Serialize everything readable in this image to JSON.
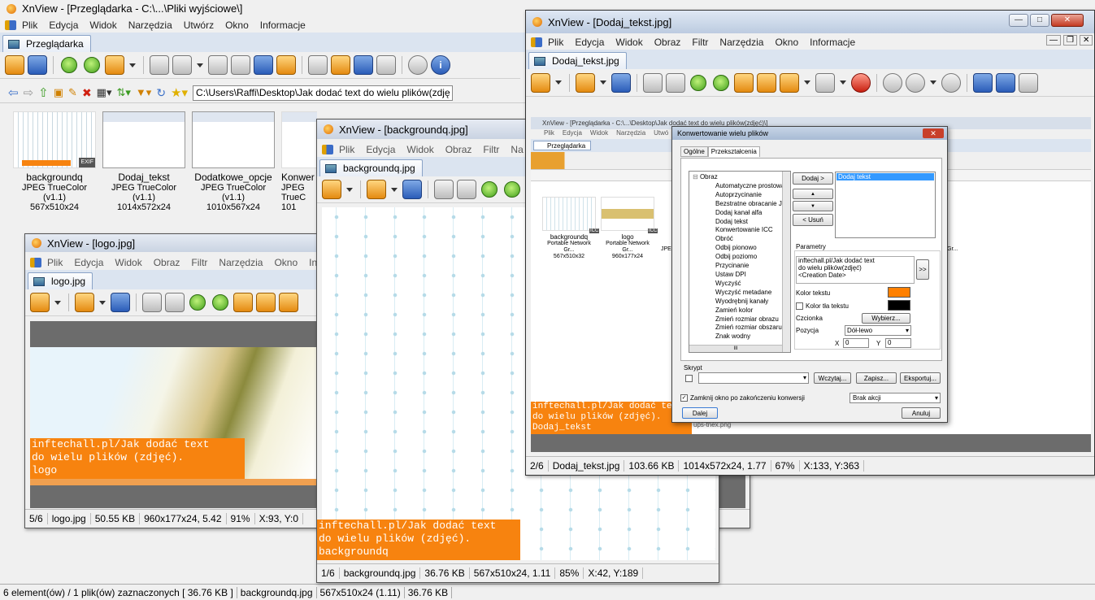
{
  "main": {
    "title": "XnView - [Przeglądarka - C:\\...\\Pliki wyjściowe\\]",
    "menu": [
      "Plik",
      "Edycja",
      "Widok",
      "Narzędzia",
      "Utwórz",
      "Okno",
      "Informacje"
    ],
    "tab": "Przeglądarka",
    "address": "C:\\Users\\Raffi\\Desktop\\Jak dodać text do wielu plików(zdję",
    "thumbs": [
      {
        "name": "backgroundq",
        "format": "JPEG TrueColor (v1.1)",
        "dims": "567x510x24"
      },
      {
        "name": "Dodaj_tekst",
        "format": "JPEG TrueColor (v1.1)",
        "dims": "1014x572x24"
      },
      {
        "name": "Dodatkowe_opcje",
        "format": "JPEG TrueColor (v1.1)",
        "dims": "1010x567x24"
      },
      {
        "name": "Konwer",
        "format": "JPEG TrueC",
        "dims": "101"
      }
    ],
    "exif": "EXIF",
    "status": [
      "6 element(ów) / 1 plik(ów) zaznaczonych  [ 36.76 KB ]",
      "backgroundq.jpg",
      "567x510x24 (1.11)",
      "36.76 KB"
    ]
  },
  "logo_win": {
    "title": "XnView - [logo.jpg]",
    "menu": [
      "Plik",
      "Edycja",
      "Widok",
      "Obraz",
      "Filtr",
      "Narzędzia",
      "Okno",
      "In"
    ],
    "tab": "logo.jpg",
    "overlay": "inftechall.pl/Jak dodać text\ndo wielu plików (zdjęć).\nlogo",
    "status": [
      "5/6",
      "logo.jpg",
      "50.55 KB",
      "960x177x24, 5.42",
      "91%",
      "X:93, Y:0"
    ]
  },
  "bg_win": {
    "title": "XnView - [backgroundq.jpg]",
    "menu": [
      "Plik",
      "Edycja",
      "Widok",
      "Obraz",
      "Filtr",
      "Na"
    ],
    "tab": "backgroundq.jpg",
    "overlay": "inftechall.pl/Jak dodać text\ndo wielu plików (zdjęć).\nbackgroundq",
    "status": [
      "1/6",
      "backgroundq.jpg",
      "36.76 KB",
      "567x510x24, 1.11",
      "85%",
      "X:42, Y:189"
    ]
  },
  "dt_win": {
    "title": "XnView - [Dodaj_tekst.jpg]",
    "menu": [
      "Plik",
      "Edycja",
      "Widok",
      "Obraz",
      "Filtr",
      "Narzędzia",
      "Okno",
      "Informacje"
    ],
    "tab": "Dodaj_tekst.jpg",
    "overlay": "inftechall.pl/Jak dodać text\ndo wielu plików (zdjęć).\nDodaj_tekst",
    "status": [
      "2/6",
      "Dodaj_tekst.jpg",
      "103.66 KB",
      "1014x572x24, 1.77",
      "67%",
      "X:133, Y:363"
    ],
    "inner_title": "XnView - [Przeglądarka - C:\\...\\Desktop\\Jak dodać text do wielu plików(zdjęć)\\]",
    "inner_menu": [
      "Plik",
      "Edycja",
      "Widok",
      "Narzędzia",
      "Utwó"
    ],
    "inner_tab": "Przeglądarka",
    "inner_thumbs": [
      {
        "name": "backgroundq",
        "format": "Portable Network Gr...",
        "dims": "567x510x32"
      },
      {
        "name": "logo",
        "format": "Portable Network Gr...",
        "dims": "960x177x24"
      }
    ],
    "inner_fragment": "JPE",
    "inner_fragment2": "Gr...",
    "inner_bottom": "ups-tnex.png",
    "icc": "ICC"
  },
  "dialog": {
    "title": "Konwertowanie wielu plików",
    "tabs": [
      "Ogólne",
      "Przekształcenia"
    ],
    "tree_root": "Obraz",
    "tree_items": [
      "Automatyczne prostowanie",
      "Autoprzycinanie",
      "Bezstratne obracanie JP",
      "Dodaj kanał alfa",
      "Dodaj tekst",
      "Konwertowanie ICC",
      "Obróć",
      "Odbij pionowo",
      "Odbij poziomo",
      "Przycinanie",
      "Ustaw DPI",
      "Wyczyść",
      "Wyczyść metadane",
      "Wyodrębnij kanały",
      "Zamień kolor",
      "Zmień rozmiar obrazu",
      "Zmień rozmiar obszaru ro",
      "Znak wodny"
    ],
    "scroll_mark": "III",
    "add_btn": "Dodaj >",
    "up_btn": "▲",
    "down_btn": "▼",
    "remove_btn": "< Usuń",
    "selected_item": "Dodaj tekst",
    "params_label": "Parametry",
    "param_text": "inftechall.pl/Jak dodać text\ndo wielu plików(zdjęć)\n<Creation Date>",
    "expand_btn": ">>",
    "text_color_label": "Kolor tekstu",
    "text_color": "#ff8000",
    "bg_color_label": "Kolor tła tekstu",
    "bg_color": "#000000",
    "font_label": "Czcionka",
    "font_btn": "Wybierz...",
    "position_label": "Pozycja",
    "position_value": "Dół-lewo",
    "x_label": "X",
    "x_value": "0",
    "y_label": "Y",
    "y_value": "0",
    "script_label": "Skrypt",
    "load_btn": "Wczytaj...",
    "save_btn": "Zapisz...",
    "export_btn": "Eksportuj...",
    "close_label": "Zamknij okno po zakończeniu konwersji",
    "action_value": "Brak akcji",
    "next_btn": "Dalej",
    "cancel_btn": "Anuluj"
  },
  "colors": {
    "overlay": "#f7830f",
    "titlebar": "#c9d3e2",
    "tab_bg": "#dbe4f0"
  }
}
